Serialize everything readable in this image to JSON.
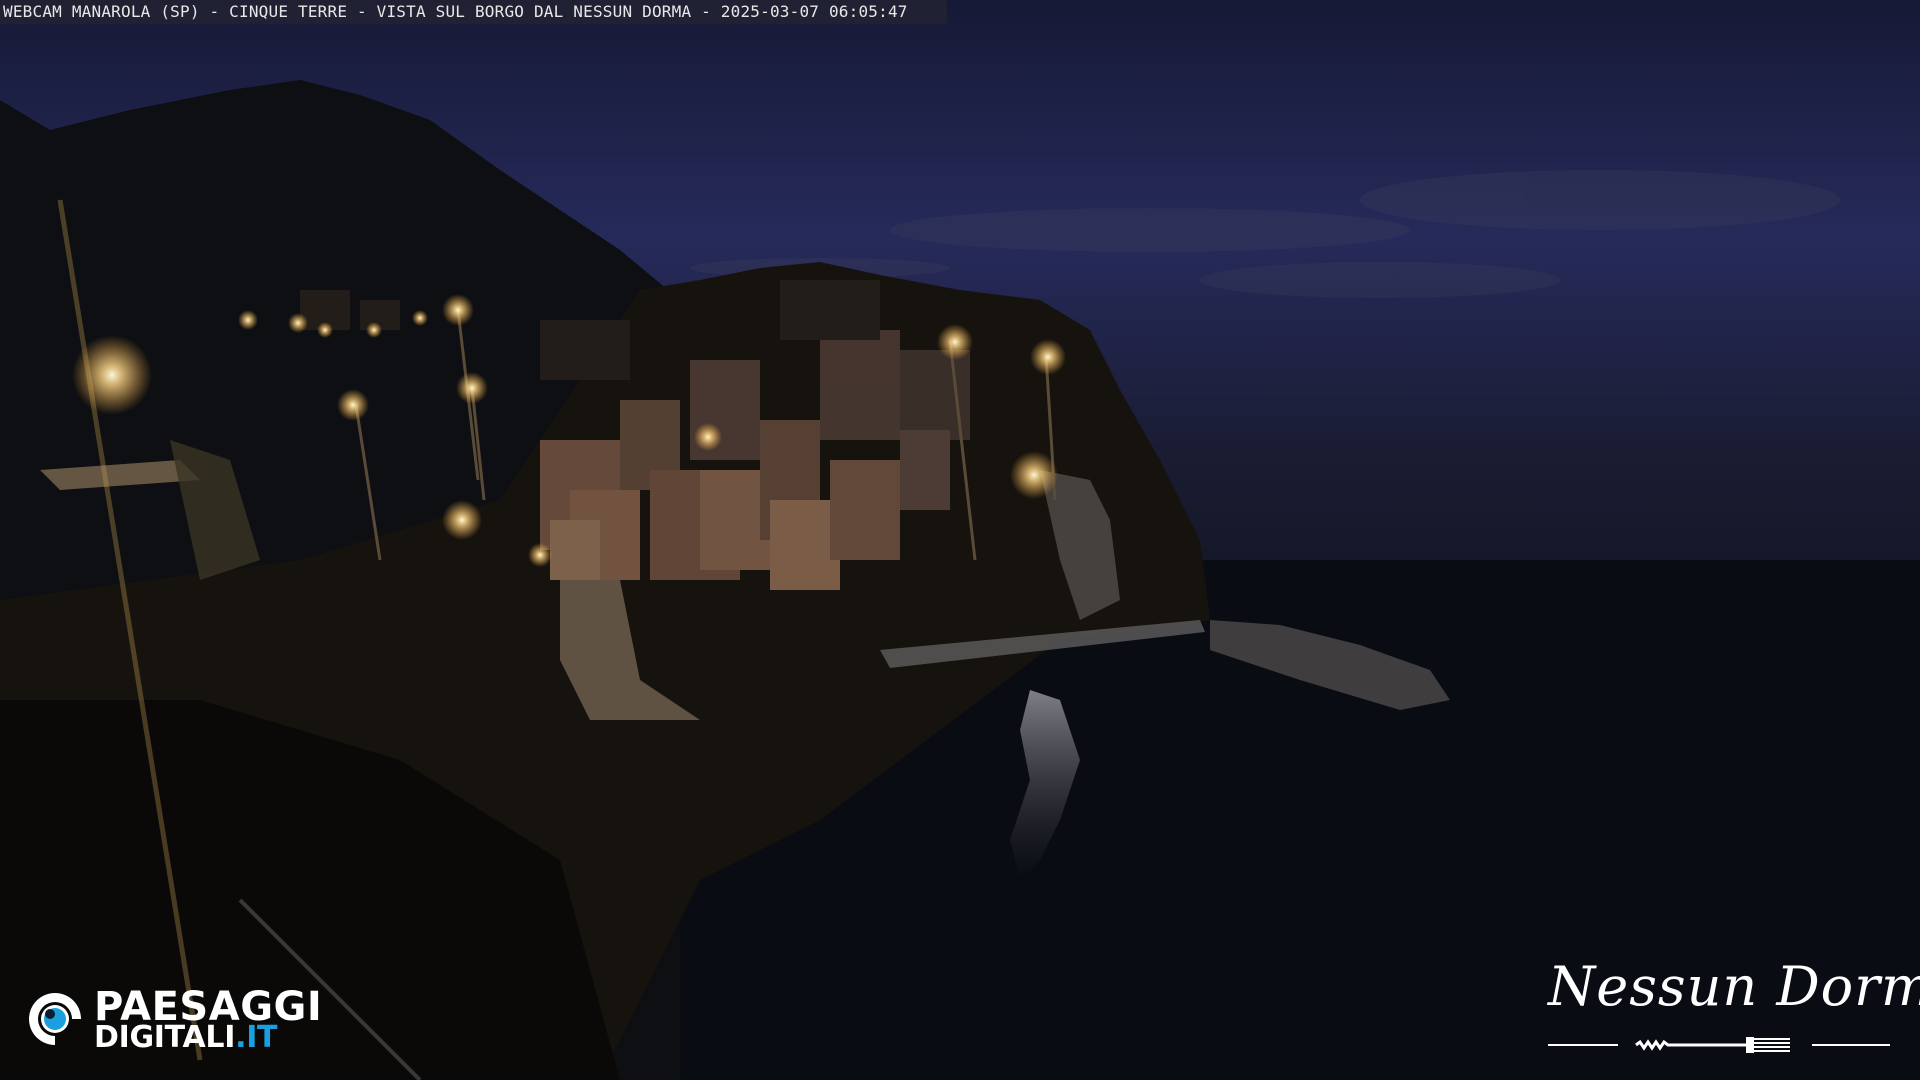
{
  "overlay": {
    "caption": "WEBCAM MANAROLA (SP) - CINQUE TERRE - VISTA SUL BORGO DAL NESSUN DORMA - 2025-03-07 06:05:47"
  },
  "logo_left": {
    "line1": "PAESAGGI",
    "line2_main": "DIGITALI",
    "line2_suffix": ".IT",
    "accent_color": "#1aa0e0"
  },
  "logo_right": {
    "text": "Nessun Dorma",
    "icon": "fork-icon"
  },
  "scene": {
    "sky_color": "#1f2148",
    "sea_color": "#0a0d16",
    "light_color": "#ffd98a"
  }
}
